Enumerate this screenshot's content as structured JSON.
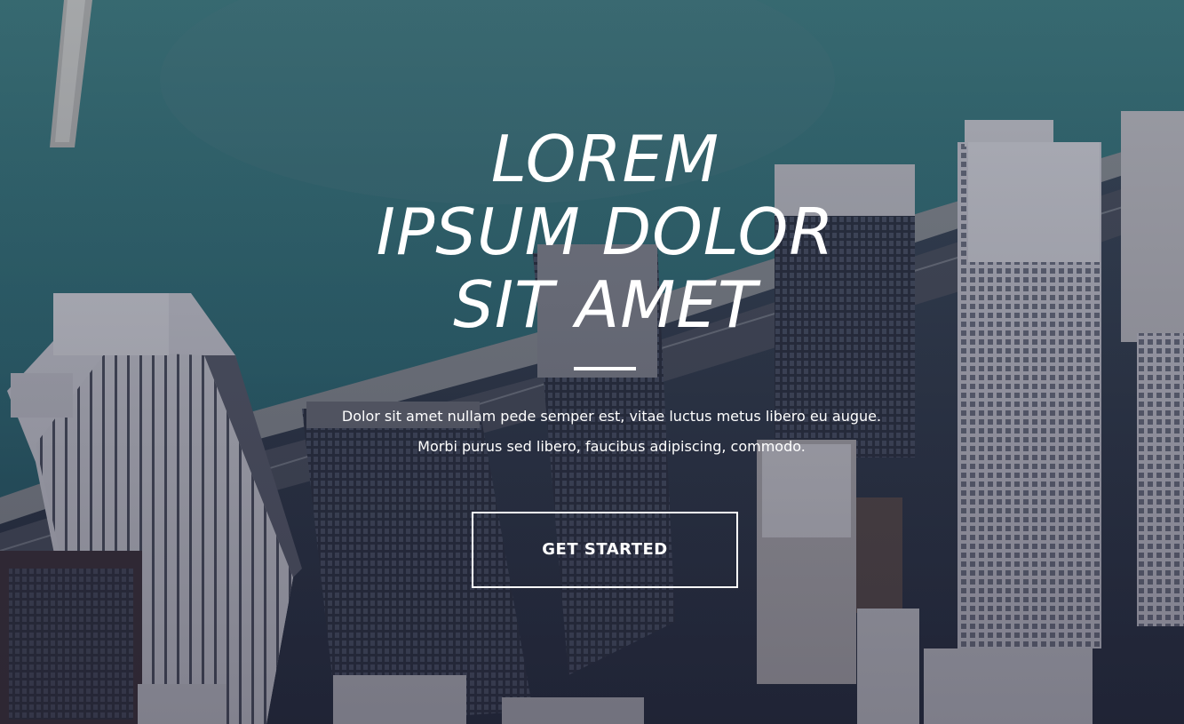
{
  "hero": {
    "title_lines": [
      "LOREM",
      "IPSUM DOLOR",
      "SIT AMET"
    ],
    "subtitle_lines": [
      "Dolor sit amet nullam pede semper est, vitae luctus metus libero eu augue.",
      "Morbi purus sed libero, faucibus adipiscing, commodo."
    ],
    "cta_label": "GET STARTED"
  },
  "colors": {
    "text": "#ffffff",
    "water": "#2f6a72",
    "building_light": "#d8d6dc",
    "building_dark": "#2a2e3c",
    "overlay": "#1e2d41"
  }
}
